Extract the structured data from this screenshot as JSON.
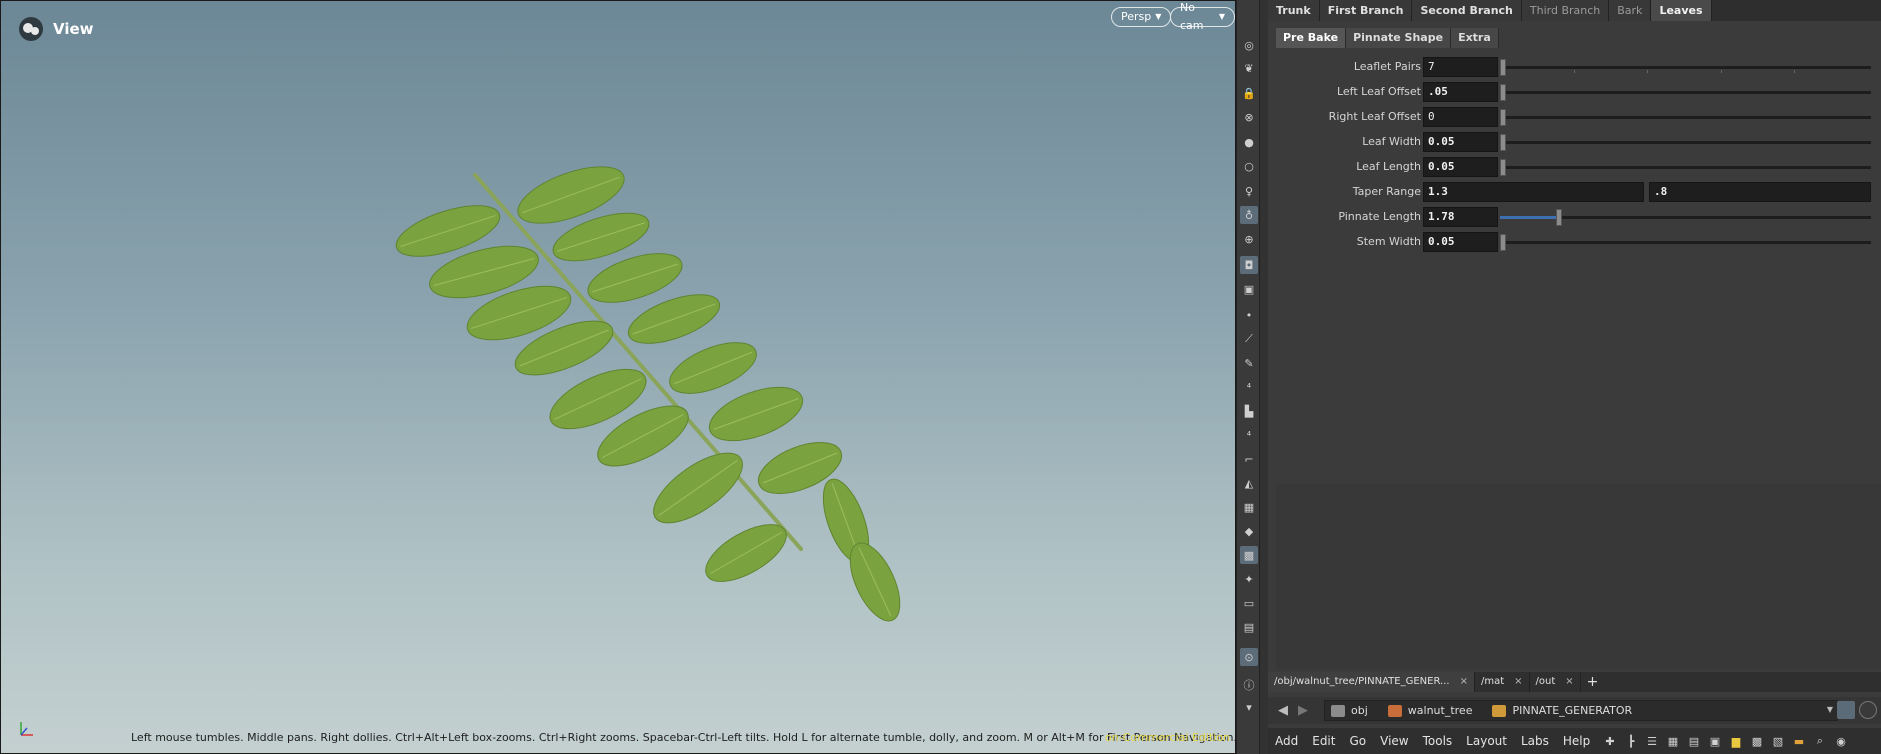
{
  "viewport": {
    "title": "View",
    "persp_label": "Persp",
    "cam_label": "No cam",
    "status_message": "Left mouse tumbles. Middle pans. Right dollies. Ctrl+Alt+Left box-zooms. Ctrl+Right zooms. Spacebar-Ctrl-Left tilts. Hold L for alternate tumble, dolly, and zoom. M or Alt+M for First Person Navigation.",
    "edition": "on-Commercial Edition",
    "leaf_color": "#7aa33f"
  },
  "toolbar": {
    "icons": [
      "eye-icon",
      "leaf-tool-icon",
      "lock-icon",
      "snap-icon",
      "sphere-icon",
      "light-bulb-icon",
      "light-icon",
      "light-pin-icon",
      "globe-icon",
      "camera-icon",
      "camera-rig-icon",
      "point-icon",
      "brush-icon",
      "pen-icon",
      "number-12-icon",
      "paint-icon",
      "number-12b-icon",
      "corner-icon",
      "sculpt-icon",
      "texture-icon",
      "diamond-icon",
      "image-icon",
      "node-icon",
      "box-icon",
      "display-icon",
      "pin-icon",
      "info-icon",
      "arrow-down-icon"
    ]
  },
  "panel": {
    "tabs": [
      {
        "label": "Trunk",
        "state": "normal"
      },
      {
        "label": "First Branch",
        "state": "normal"
      },
      {
        "label": "Second Branch",
        "state": "normal"
      },
      {
        "label": "Third Branch",
        "state": "dim"
      },
      {
        "label": "Bark",
        "state": "dim"
      },
      {
        "label": "Leaves",
        "state": "active"
      }
    ],
    "subtabs": [
      {
        "label": "Pre Bake",
        "state": "active"
      },
      {
        "label": "Pinnate Shape",
        "state": "normal"
      },
      {
        "label": "Extra",
        "state": "normal"
      }
    ],
    "params": {
      "leaflet_pairs": {
        "label": "Leaflet Pairs",
        "value": "7",
        "slider": 0.0
      },
      "left_leaf_offset": {
        "label": "Left Leaf Offset",
        "value": ".05",
        "slider": 0.0
      },
      "right_leaf_offset": {
        "label": "Right Leaf Offset",
        "value": "0",
        "slider": 0.0
      },
      "leaf_width": {
        "label": "Leaf Width",
        "value": "0.05",
        "slider": 0.0
      },
      "leaf_length": {
        "label": "Leaf Length",
        "value": "0.05",
        "slider": 0.0
      },
      "taper_range": {
        "label": "Taper Range",
        "value_min": "1.3",
        "value_max": ".8"
      },
      "pinnate_length": {
        "label": "Pinnate Length",
        "value": "1.78",
        "slider": 0.15
      },
      "stem_width": {
        "label": "Stem Width",
        "value": "0.05",
        "slider": 0.0
      }
    }
  },
  "pathtabs": [
    {
      "label": "/obj/walnut_tree/PINNATE_GENER...",
      "active": true
    },
    {
      "label": "/mat",
      "active": false
    },
    {
      "label": "/out",
      "active": false
    }
  ],
  "pathtab_close": "×",
  "pathtab_add": "+",
  "breadcrumbs": [
    {
      "label": "obj",
      "color": "#8c8c8c"
    },
    {
      "label": "walnut_tree",
      "color": "#c96d3a"
    },
    {
      "label": "PINNATE_GENERATOR",
      "color": "#d09a3a"
    }
  ],
  "menubar": [
    "Add",
    "Edit",
    "Go",
    "View",
    "Tools",
    "Layout",
    "Labs",
    "Help"
  ]
}
